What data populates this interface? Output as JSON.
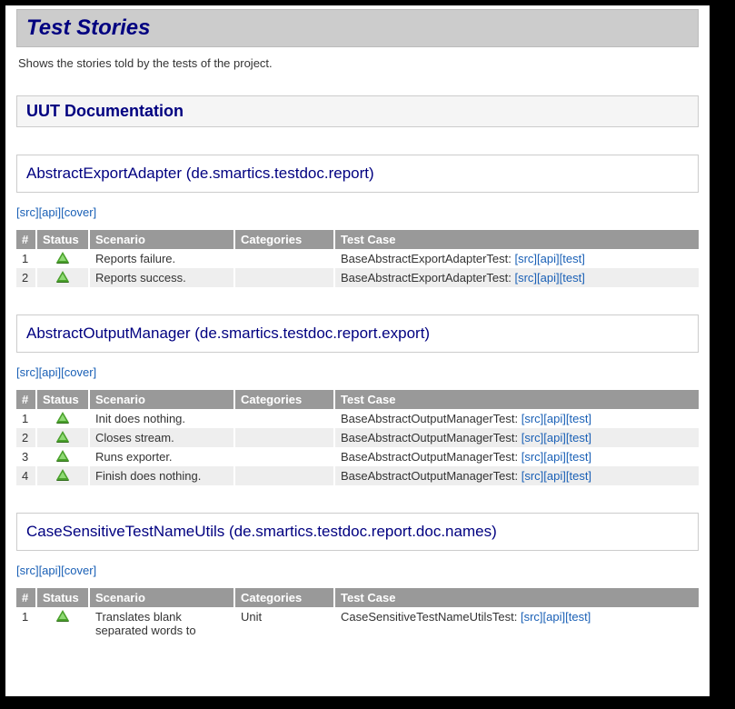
{
  "page": {
    "title": "Test Stories",
    "intro": "Shows the stories told by the tests of the project.",
    "section_title": "UUT Documentation"
  },
  "headers": {
    "num": "#",
    "status": "Status",
    "scenario": "Scenario",
    "categories": "Categories",
    "testcase": "Test Case"
  },
  "links": {
    "src": "[src]",
    "api": "[api]",
    "cover": "[cover]",
    "test": "[test]"
  },
  "uuts": [
    {
      "title": "AbstractExportAdapter (de.smartics.testdoc.report)",
      "rows": [
        {
          "num": "1",
          "scenario": "Reports failure.",
          "categories": "",
          "testcase": "BaseAbstractExportAdapterTest:"
        },
        {
          "num": "2",
          "scenario": "Reports success.",
          "categories": "",
          "testcase": "BaseAbstractExportAdapterTest:"
        }
      ]
    },
    {
      "title": "AbstractOutputManager (de.smartics.testdoc.report.export)",
      "rows": [
        {
          "num": "1",
          "scenario": "Init does nothing.",
          "categories": "",
          "testcase": "BaseAbstractOutputManagerTest:"
        },
        {
          "num": "2",
          "scenario": "Closes stream.",
          "categories": "",
          "testcase": "BaseAbstractOutputManagerTest:"
        },
        {
          "num": "3",
          "scenario": "Runs exporter.",
          "categories": "",
          "testcase": "BaseAbstractOutputManagerTest:"
        },
        {
          "num": "4",
          "scenario": "Finish does nothing.",
          "categories": "",
          "testcase": "BaseAbstractOutputManagerTest:"
        }
      ]
    },
    {
      "title": "CaseSensitiveTestNameUtils (de.smartics.testdoc.report.doc.names)",
      "rows": [
        {
          "num": "1",
          "scenario": "Translates blank separated words to",
          "categories": "Unit",
          "testcase": "CaseSensitiveTestNameUtilsTest:"
        }
      ]
    }
  ]
}
